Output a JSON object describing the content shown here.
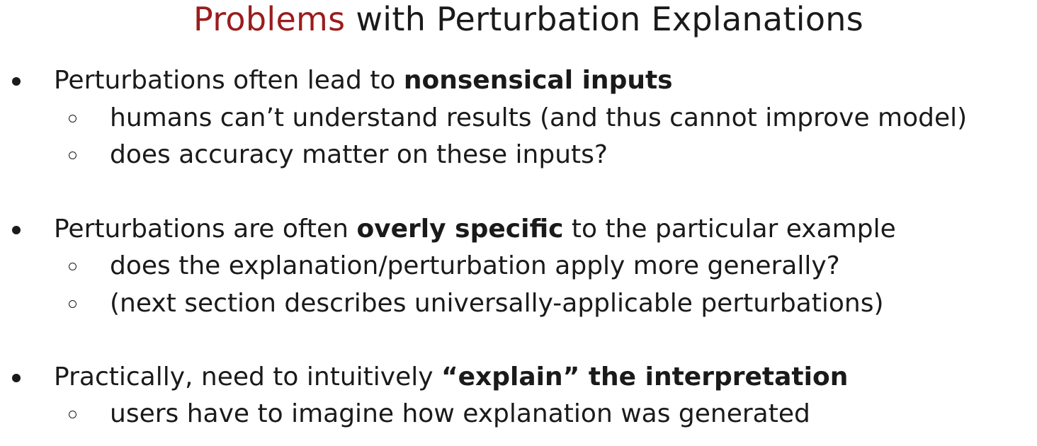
{
  "slide": {
    "title": {
      "accent": "Problems",
      "rest": " with Perturbation Explanations"
    },
    "accent_color": "#9b1c1c",
    "sections": [
      {
        "bullet": {
          "before": "Perturbations often lead to ",
          "bold": "nonsensical inputs",
          "after": ""
        },
        "sub": [
          "humans can’t understand results (and thus cannot improve model)",
          "does accuracy matter on these inputs?"
        ]
      },
      {
        "bullet": {
          "before": "Perturbations are often ",
          "bold": "overly specific",
          "after": " to the particular example"
        },
        "sub": [
          "does the explanation/perturbation apply more generally?",
          "(next section describes universally-applicable perturbations)"
        ]
      },
      {
        "bullet": {
          "before": "Practically, need to intuitively ",
          "bold": "“explain” the interpretation",
          "after": ""
        },
        "sub": [
          "users have to imagine how explanation was generated"
        ]
      }
    ]
  }
}
